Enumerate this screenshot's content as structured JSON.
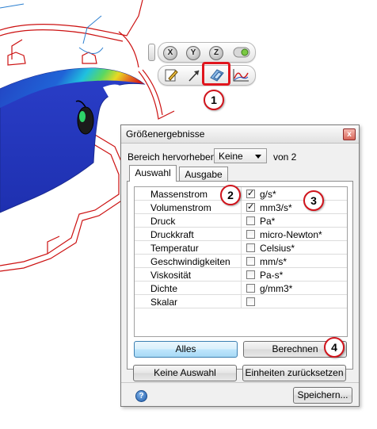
{
  "dialog": {
    "title": "Größenergebnisse",
    "highlight_label": "Bereich hervorheben:",
    "highlight_value": "Keine",
    "of_label": "von 2",
    "tabs": [
      "Auswahl",
      "Ausgabe"
    ],
    "rows": [
      {
        "name": "Massenstrom",
        "checked": true,
        "unit": "g/s*"
      },
      {
        "name": "Volumenstrom",
        "checked": true,
        "unit": "mm3/s*"
      },
      {
        "name": "Druck",
        "checked": false,
        "unit": "Pa*"
      },
      {
        "name": "Druckkraft",
        "checked": false,
        "unit": "micro-Newton*"
      },
      {
        "name": "Temperatur",
        "checked": false,
        "unit": "Celsius*"
      },
      {
        "name": "Geschwindigkeiten",
        "checked": false,
        "unit": "mm/s*"
      },
      {
        "name": "Viskosität",
        "checked": false,
        "unit": "Pa-s*"
      },
      {
        "name": "Dichte",
        "checked": false,
        "unit": "g/mm3*"
      },
      {
        "name": "Skalar",
        "checked": false,
        "unit": ""
      }
    ],
    "buttons": {
      "all": "Alles",
      "calculate": "Berechnen",
      "none": "Keine Auswahl",
      "reset_units": "Einheiten zurücksetzen",
      "save": "Speichern..."
    },
    "help_glyph": "?",
    "close_glyph": "x"
  },
  "toolbar": {
    "axis_buttons": [
      "X",
      "Y",
      "Z"
    ],
    "icons": [
      "view-toggle-icon",
      "edit-icon",
      "arrow-icon",
      "surface-parts-icon",
      "xy-plot-icon"
    ]
  },
  "callouts": [
    "1",
    "2",
    "3",
    "4"
  ],
  "colors": {
    "highlight_red": "#e0161e",
    "fluid_blue": "#2a45c8",
    "dialog_bg": "#f0f0f0"
  }
}
